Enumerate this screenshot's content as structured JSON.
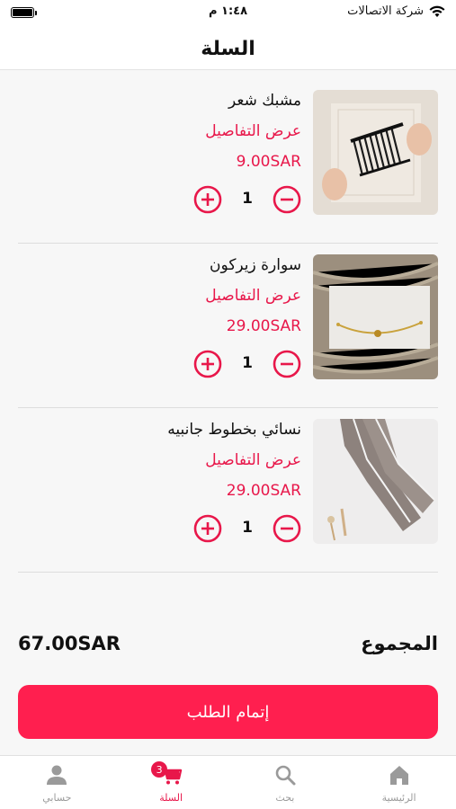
{
  "status_bar": {
    "carrier": "شركة الاتصالات",
    "time": "١:٤٨ م"
  },
  "header": {
    "title": "السلة"
  },
  "cart": {
    "items": [
      {
        "name": "مشبك شعر",
        "details_link": "عرض التفاصيل",
        "price": "9.00SAR",
        "quantity": "1",
        "image": "hair-clip-photo"
      },
      {
        "name": "سوارة زيركون",
        "details_link": "عرض التفاصيل",
        "price": "29.00SAR",
        "quantity": "1",
        "image": "zircon-bracelet-photo"
      },
      {
        "name": "نسائي بخطوط جانبيه",
        "details_link": "عرض التفاصيل",
        "price": "29.00SAR",
        "quantity": "1",
        "image": "side-stripe-leggings-photo"
      }
    ],
    "total_label": "المجموع",
    "total_value": "67.00SAR",
    "checkout_label": "إتمام الطلب"
  },
  "tab_bar": {
    "tabs": [
      {
        "label": "الرئيسية",
        "icon": "home-icon"
      },
      {
        "label": "بحث",
        "icon": "search-icon"
      },
      {
        "label": "السلة",
        "icon": "cart-icon",
        "badge": "3",
        "active": true
      },
      {
        "label": "حسابي",
        "icon": "user-icon"
      }
    ]
  },
  "colors": {
    "accent": "#e8174a",
    "button": "#ff1f4f",
    "inactive": "#9a9a9a"
  }
}
